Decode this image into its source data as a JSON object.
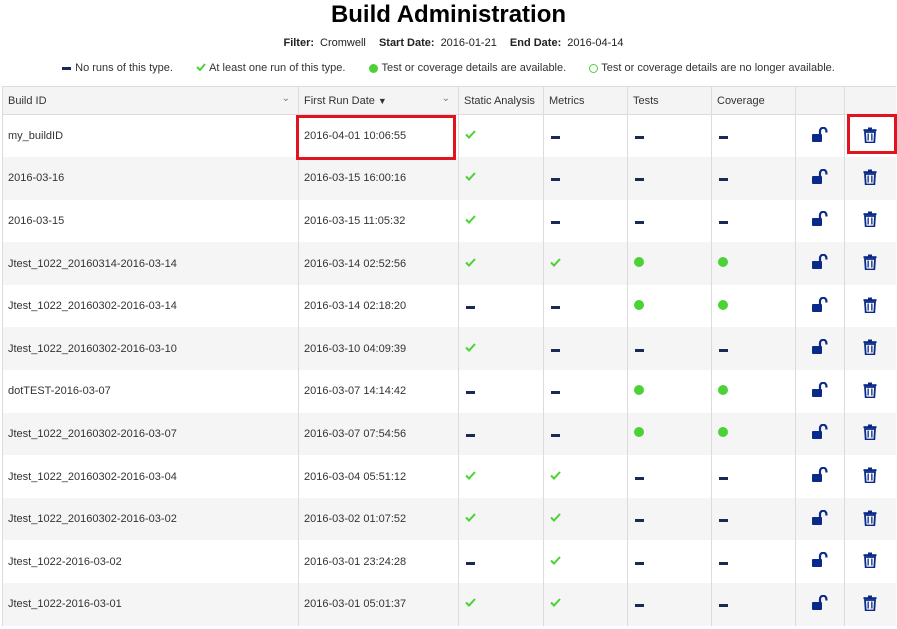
{
  "title": "Build Administration",
  "filters": {
    "filter_label": "Filter:",
    "filter_value": "Cromwell",
    "start_label": "Start Date:",
    "start_value": "2016-01-21",
    "end_label": "End Date:",
    "end_value": "2016-04-14"
  },
  "legend": {
    "none": "No runs of this type.",
    "at_least_one": "At least one run of this type.",
    "available": "Test or coverage details are available.",
    "no_longer": "Test or coverage details are no longer available."
  },
  "columns": {
    "build_id": "Build ID",
    "first_run": "First Run Date",
    "static": "Static Analysis",
    "metrics": "Metrics",
    "tests": "Tests",
    "coverage": "Coverage"
  },
  "sort_indicator": "▼",
  "colors": {
    "accent_navy": "#0a2a8a",
    "green": "#4cd137",
    "highlight_red": "#e0131f"
  },
  "rows": [
    {
      "build_id": "my_buildID",
      "first_run": "2016-04-01 10:06:55",
      "static": "check",
      "metrics": "dash",
      "tests": "dash",
      "coverage": "dash"
    },
    {
      "build_id": "2016-03-16",
      "first_run": "2016-03-15 16:00:16",
      "static": "check",
      "metrics": "dash",
      "tests": "dash",
      "coverage": "dash"
    },
    {
      "build_id": "2016-03-15",
      "first_run": "2016-03-15 11:05:32",
      "static": "check",
      "metrics": "dash",
      "tests": "dash",
      "coverage": "dash"
    },
    {
      "build_id": "Jtest_1022_20160314-2016-03-14",
      "first_run": "2016-03-14 02:52:56",
      "static": "check",
      "metrics": "check",
      "tests": "dot",
      "coverage": "dot"
    },
    {
      "build_id": "Jtest_1022_20160302-2016-03-14",
      "first_run": "2016-03-14 02:18:20",
      "static": "dash",
      "metrics": "dash",
      "tests": "dot",
      "coverage": "dot"
    },
    {
      "build_id": "Jtest_1022_20160302-2016-03-10",
      "first_run": "2016-03-10 04:09:39",
      "static": "check",
      "metrics": "dash",
      "tests": "dash",
      "coverage": "dash"
    },
    {
      "build_id": "dotTEST-2016-03-07",
      "first_run": "2016-03-07 14:14:42",
      "static": "dash",
      "metrics": "dash",
      "tests": "dot",
      "coverage": "dot"
    },
    {
      "build_id": "Jtest_1022_20160302-2016-03-07",
      "first_run": "2016-03-07 07:54:56",
      "static": "dash",
      "metrics": "dash",
      "tests": "dot",
      "coverage": "dot"
    },
    {
      "build_id": "Jtest_1022_20160302-2016-03-04",
      "first_run": "2016-03-04 05:51:12",
      "static": "check",
      "metrics": "check",
      "tests": "dash",
      "coverage": "dash"
    },
    {
      "build_id": "Jtest_1022_20160302-2016-03-02",
      "first_run": "2016-03-02 01:07:52",
      "static": "check",
      "metrics": "check",
      "tests": "dash",
      "coverage": "dash"
    },
    {
      "build_id": "Jtest_1022-2016-03-02",
      "first_run": "2016-03-01 23:24:28",
      "static": "dash",
      "metrics": "check",
      "tests": "dash",
      "coverage": "dash"
    },
    {
      "build_id": "Jtest_1022-2016-03-01",
      "first_run": "2016-03-01 05:01:37",
      "static": "check",
      "metrics": "check",
      "tests": "dash",
      "coverage": "dash"
    }
  ]
}
